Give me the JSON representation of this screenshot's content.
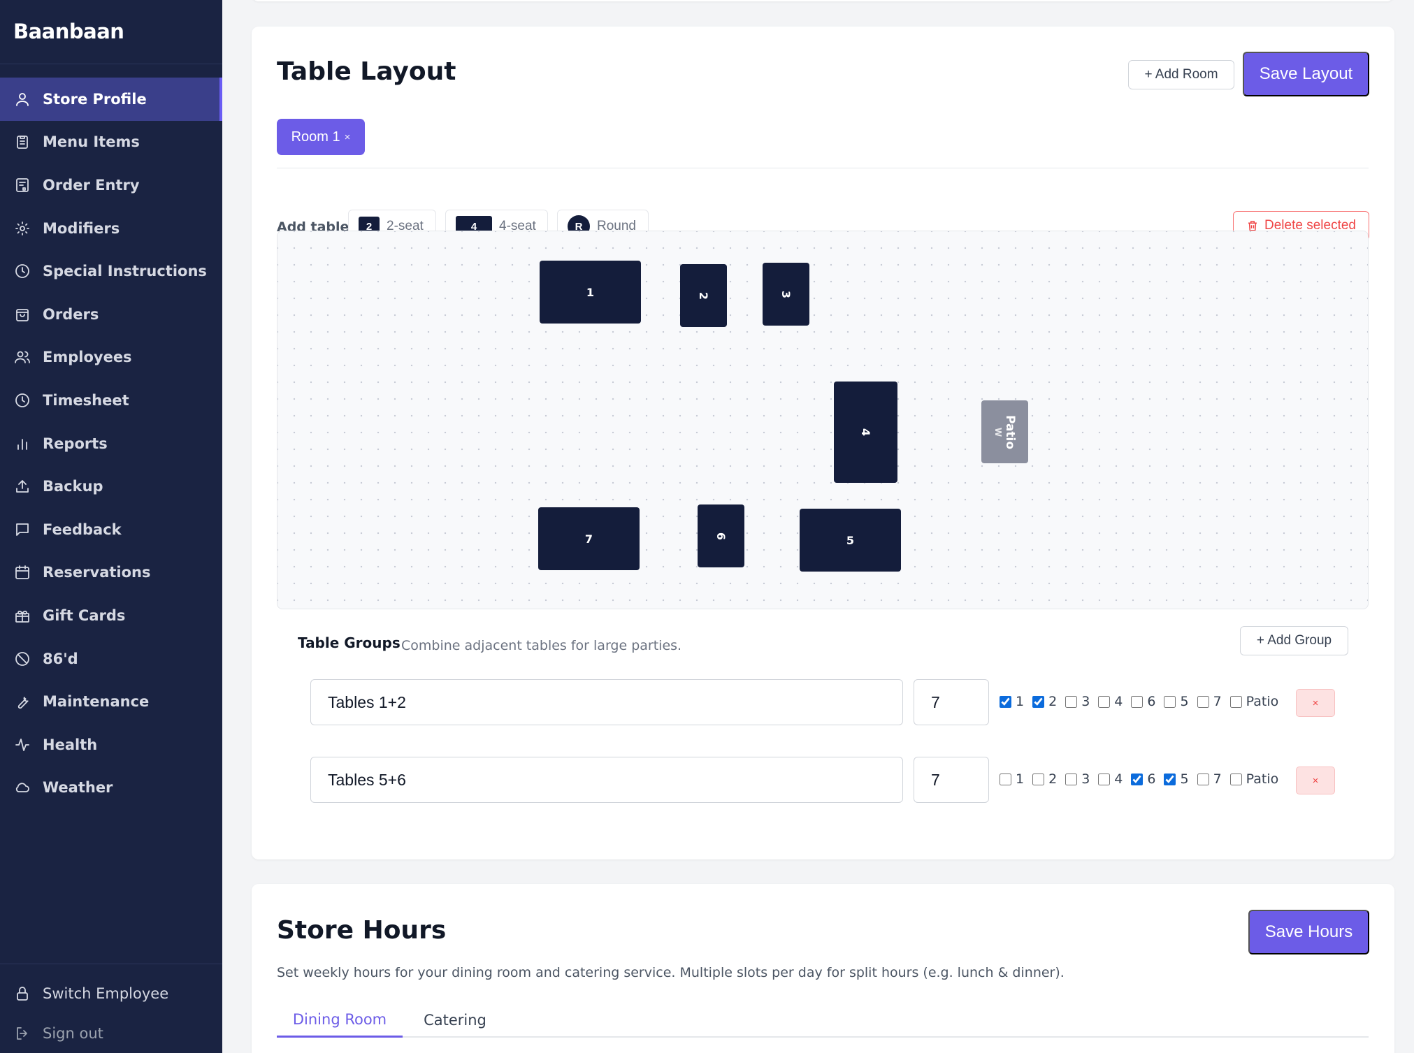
{
  "sidebar": {
    "brand": "Baanbaan",
    "items": [
      {
        "label": "Store Profile",
        "icon": "user-icon"
      },
      {
        "label": "Menu Items",
        "icon": "clipboard-icon"
      },
      {
        "label": "Order Entry",
        "icon": "order-entry-icon"
      },
      {
        "label": "Modifiers",
        "icon": "sun-icon"
      },
      {
        "label": "Special Instructions",
        "icon": "clock-icon"
      },
      {
        "label": "Orders",
        "icon": "shopping-bag-icon"
      },
      {
        "label": "Employees",
        "icon": "users-icon"
      },
      {
        "label": "Timesheet",
        "icon": "clock-icon"
      },
      {
        "label": "Reports",
        "icon": "bar-chart-icon"
      },
      {
        "label": "Backup",
        "icon": "upload-icon"
      },
      {
        "label": "Feedback",
        "icon": "message-icon"
      },
      {
        "label": "Reservations",
        "icon": "calendar-icon"
      },
      {
        "label": "Gift Cards",
        "icon": "gift-icon"
      },
      {
        "label": "86'd",
        "icon": "ban-icon"
      },
      {
        "label": "Maintenance",
        "icon": "wrench-icon"
      },
      {
        "label": "Health",
        "icon": "activity-icon"
      },
      {
        "label": "Weather",
        "icon": "cloud-icon"
      }
    ],
    "active_index": 0,
    "switch_employee": "Switch Employee",
    "sign_out": "Sign out"
  },
  "table_layout": {
    "title": "Table Layout",
    "add_room": "+ Add Room",
    "save_layout": "Save Layout",
    "room_tab": "Room 1",
    "room_close": "×",
    "add_table_label": "Add table:",
    "tools": [
      {
        "swatch": "2",
        "label": "2-seat"
      },
      {
        "swatch": "4",
        "label": "4-seat"
      },
      {
        "swatch": "R",
        "label": "Round"
      }
    ],
    "delete_selected": "Delete selected",
    "tables": [
      {
        "label": "1"
      },
      {
        "label": "2"
      },
      {
        "label": "3"
      },
      {
        "label": "4"
      },
      {
        "label": "7"
      },
      {
        "label": "6"
      },
      {
        "label": "5"
      }
    ],
    "patio": {
      "label": "Patio",
      "sub": "W"
    }
  },
  "table_groups": {
    "title": "Table Groups",
    "description": "Combine adjacent tables for large parties.",
    "add_group": "+ Add Group",
    "remove_label": "×",
    "options": [
      "1",
      "2",
      "3",
      "4",
      "6",
      "5",
      "7",
      "Patio"
    ],
    "groups": [
      {
        "name": "Tables 1+2",
        "capacity": "7",
        "checked": [
          true,
          true,
          false,
          false,
          false,
          false,
          false,
          false
        ]
      },
      {
        "name": "Tables 5+6",
        "capacity": "7",
        "checked": [
          false,
          false,
          false,
          false,
          true,
          true,
          false,
          false
        ]
      }
    ]
  },
  "store_hours": {
    "title": "Store Hours",
    "save_hours": "Save Hours",
    "description": "Set weekly hours for your dining room and catering service. Multiple slots per day for split hours (e.g. lunch & dinner).",
    "tabs": [
      "Dining Room",
      "Catering"
    ]
  },
  "colors": {
    "sidebar_bg": "#1a2342",
    "accent": "#6c5ce7",
    "table": "#141d3b",
    "danger": "#ef4444"
  }
}
